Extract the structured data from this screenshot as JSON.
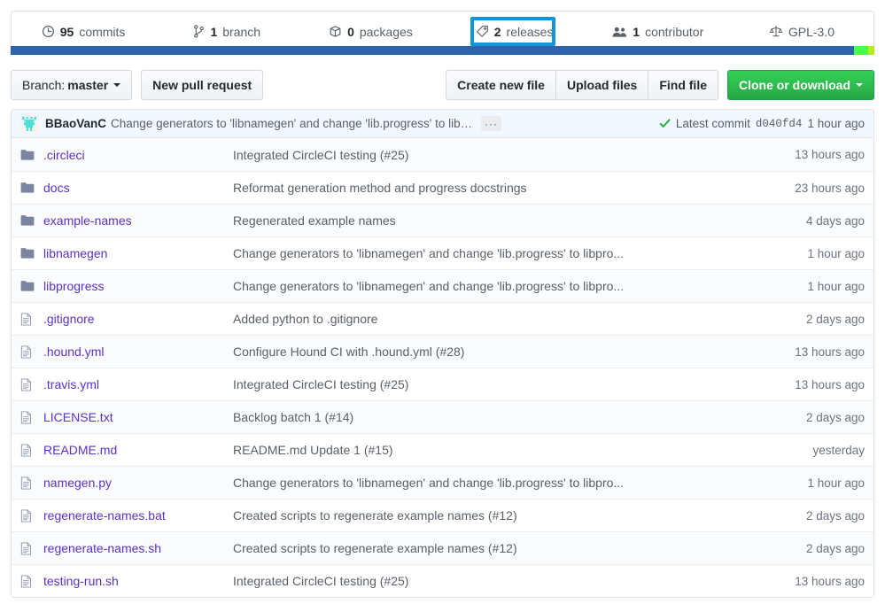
{
  "stats": [
    {
      "icon": "history-icon",
      "num": "95",
      "label": "commits",
      "name": "stat-commits"
    },
    {
      "icon": "branch-icon",
      "num": "1",
      "label": "branch",
      "name": "stat-branches"
    },
    {
      "icon": "package-icon",
      "num": "0",
      "label": "packages",
      "name": "stat-packages"
    },
    {
      "icon": "tag-icon",
      "num": "2",
      "label": "releases",
      "name": "stat-releases"
    },
    {
      "icon": "people-icon",
      "num": "1",
      "label": "contributor",
      "name": "stat-contributors"
    },
    {
      "icon": "law-icon",
      "num": "",
      "label": "GPL-3.0",
      "name": "stat-license"
    }
  ],
  "highlight": {
    "color": "#1296d8",
    "target": "stat-releases"
  },
  "language_bar": [
    {
      "name": "blue-segment",
      "color": "#2f63ab",
      "percent": 97.6
    },
    {
      "name": "green-segment",
      "color": "#4dfb4d",
      "percent": 1.7
    },
    {
      "name": "yellow-green-segment",
      "color": "#b4ec2a",
      "percent": 0.7
    }
  ],
  "toolbar": {
    "branch_prefix": "Branch:",
    "branch_name": "master",
    "new_pull_request": "New pull request",
    "create_new_file": "Create new file",
    "upload_files": "Upload files",
    "find_file": "Find file",
    "clone_or_download": "Clone or download"
  },
  "commit_header": {
    "author": "BBaoVanC",
    "message": "Change generators to 'libnamegen' and change 'lib.progress' to libpro...",
    "ellipsis": "···",
    "latest_commit_label": "Latest commit",
    "sha": "d040fd4",
    "time": "1 hour ago"
  },
  "files": [
    {
      "type": "folder",
      "name": ".circleci",
      "message": "Integrated CircleCI testing (#25)",
      "time": "13 hours ago"
    },
    {
      "type": "folder",
      "name": "docs",
      "message": "Reformat generation method and progress docstrings",
      "time": "23 hours ago"
    },
    {
      "type": "folder",
      "name": "example-names",
      "message": "Regenerated example names",
      "time": "4 days ago"
    },
    {
      "type": "folder",
      "name": "libnamegen",
      "message": "Change generators to 'libnamegen' and change 'lib.progress' to libpro...",
      "time": "1 hour ago"
    },
    {
      "type": "folder",
      "name": "libprogress",
      "message": "Change generators to 'libnamegen' and change 'lib.progress' to libpro...",
      "time": "1 hour ago"
    },
    {
      "type": "file",
      "name": ".gitignore",
      "message": "Added python to .gitignore",
      "time": "2 days ago"
    },
    {
      "type": "file",
      "name": ".hound.yml",
      "message": "Configure Hound CI with .hound.yml (#28)",
      "time": "13 hours ago"
    },
    {
      "type": "file",
      "name": ".travis.yml",
      "message": "Integrated CircleCI testing (#25)",
      "time": "13 hours ago"
    },
    {
      "type": "file",
      "name": "LICENSE.txt",
      "message": "Backlog batch 1 (#14)",
      "time": "2 days ago"
    },
    {
      "type": "file",
      "name": "README.md",
      "message": "README.md Update 1 (#15)",
      "time": "yesterday"
    },
    {
      "type": "file",
      "name": "namegen.py",
      "message": "Change generators to 'libnamegen' and change 'lib.progress' to libpro...",
      "time": "1 hour ago"
    },
    {
      "type": "file",
      "name": "regenerate-names.bat",
      "message": "Created scripts to regenerate example names (#12)",
      "time": "2 days ago"
    },
    {
      "type": "file",
      "name": "regenerate-names.sh",
      "message": "Created scripts to regenerate example names (#12)",
      "time": "2 days ago"
    },
    {
      "type": "file",
      "name": "testing-run.sh",
      "message": "Integrated CircleCI testing (#25)",
      "time": "13 hours ago"
    }
  ]
}
